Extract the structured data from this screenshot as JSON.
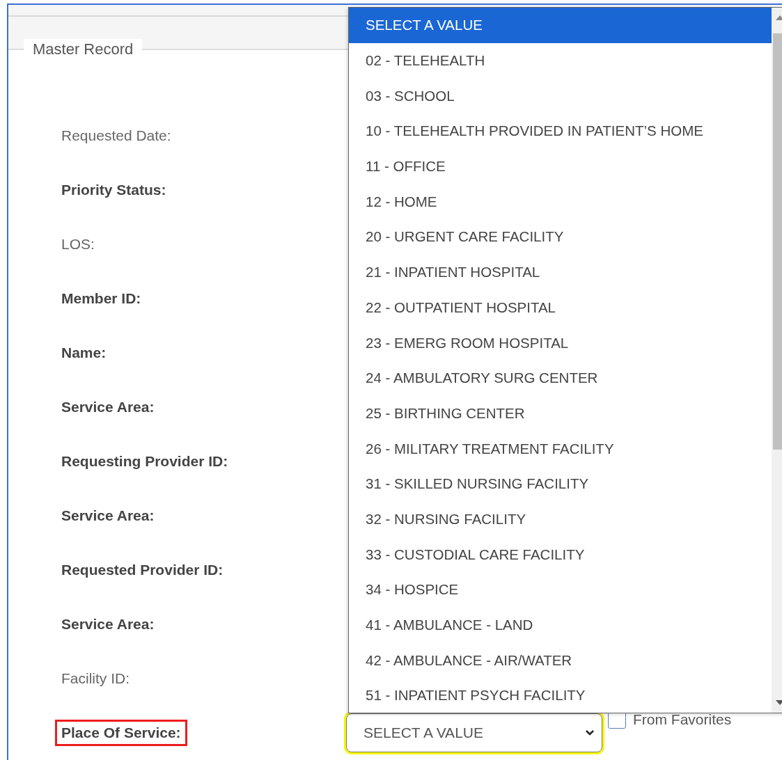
{
  "section": {
    "legend": "Master Record"
  },
  "fields": [
    {
      "label": "Requested Date:",
      "required": false,
      "highlighted": false
    },
    {
      "label": "Priority Status:",
      "required": true,
      "highlighted": false
    },
    {
      "label": "LOS:",
      "required": false,
      "highlighted": false
    },
    {
      "label": "Member ID:",
      "required": true,
      "highlighted": false
    },
    {
      "label": "Name:",
      "required": true,
      "highlighted": false
    },
    {
      "label": "Service Area:",
      "required": true,
      "highlighted": false
    },
    {
      "label": "Requesting Provider ID:",
      "required": true,
      "highlighted": false
    },
    {
      "label": "Service Area:",
      "required": true,
      "highlighted": false
    },
    {
      "label": "Requested Provider ID:",
      "required": true,
      "highlighted": false
    },
    {
      "label": "Service Area:",
      "required": true,
      "highlighted": false
    },
    {
      "label": "Facility ID:",
      "required": false,
      "highlighted": false
    },
    {
      "label": "Place Of Service:",
      "required": true,
      "highlighted": true
    }
  ],
  "place_of_service": {
    "value": "SELECT A VALUE",
    "focused": true,
    "from_favorites": {
      "label": "From Favorites",
      "checked": false
    },
    "options": [
      {
        "label": "SELECT A VALUE",
        "selected": true
      },
      {
        "label": "02 - TELEHEALTH",
        "selected": false
      },
      {
        "label": "03 - SCHOOL",
        "selected": false
      },
      {
        "label": "10 - TELEHEALTH PROVIDED IN PATIENT’S HOME",
        "selected": false
      },
      {
        "label": "11 - OFFICE",
        "selected": false
      },
      {
        "label": "12 - HOME",
        "selected": false
      },
      {
        "label": "20 - URGENT CARE FACILITY",
        "selected": false
      },
      {
        "label": "21 - INPATIENT HOSPITAL",
        "selected": false
      },
      {
        "label": "22 - OUTPATIENT HOSPITAL",
        "selected": false
      },
      {
        "label": "23 - EMERG ROOM HOSPITAL",
        "selected": false
      },
      {
        "label": "24 - AMBULATORY SURG CENTER",
        "selected": false
      },
      {
        "label": "25 - BIRTHING CENTER",
        "selected": false
      },
      {
        "label": "26 - MILITARY TREATMENT FACILITY",
        "selected": false
      },
      {
        "label": "31 - SKILLED NURSING FACILITY",
        "selected": false
      },
      {
        "label": "32 - NURSING FACILITY",
        "selected": false
      },
      {
        "label": "33 - CUSTODIAL CARE FACILITY",
        "selected": false
      },
      {
        "label": "34 - HOSPICE",
        "selected": false
      },
      {
        "label": "41 - AMBULANCE - LAND",
        "selected": false
      },
      {
        "label": "42 - AMBULANCE - AIR/WATER",
        "selected": false
      },
      {
        "label": "51 - INPATIENT PSYCH FACILITY",
        "selected": false
      }
    ]
  }
}
